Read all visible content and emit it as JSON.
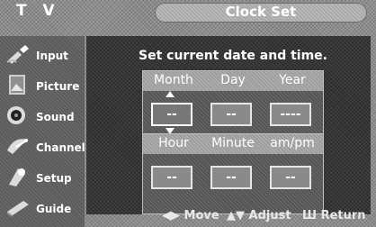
{
  "header": {
    "tv_label": "T V",
    "title": "Clock Set"
  },
  "sidebar": {
    "items": [
      {
        "label": "Input",
        "icon": "input-plug-icon"
      },
      {
        "label": "Picture",
        "icon": "picture-icon"
      },
      {
        "label": "Sound",
        "icon": "speaker-icon"
      },
      {
        "label": "Channel",
        "icon": "satellite-dish-icon"
      },
      {
        "label": "Setup",
        "icon": "setup-icon"
      },
      {
        "label": "Guide",
        "icon": "guide-icon"
      }
    ]
  },
  "main": {
    "instruction": "Set current date and time.",
    "date": {
      "labels": [
        "Month",
        "Day",
        "Year"
      ],
      "values": [
        "--",
        "--",
        "----"
      ]
    },
    "time": {
      "labels": [
        "Hour",
        "Minute",
        "am/pm"
      ],
      "values": [
        "--",
        "--",
        "--"
      ]
    }
  },
  "footer": {
    "move": "Move",
    "adjust": "Adjust",
    "return": "Return"
  }
}
